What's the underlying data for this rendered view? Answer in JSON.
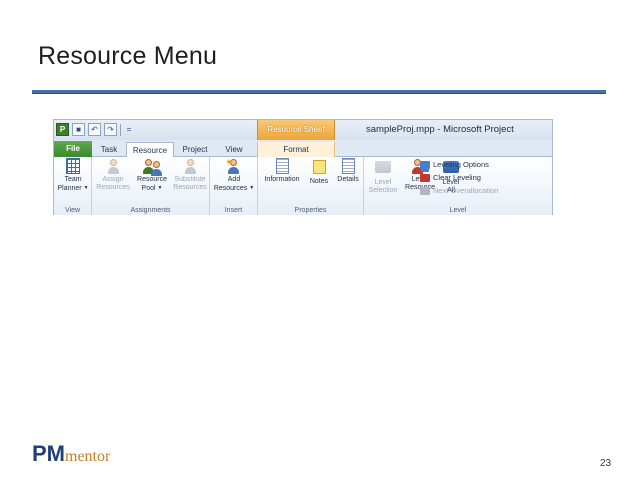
{
  "slide": {
    "title": "Resource Menu",
    "page_number": "23"
  },
  "logo": {
    "pm": "PM",
    "rest": "mentor",
    "colors": {
      "pm": "#1f3f7a",
      "rest": "#c57f23"
    }
  },
  "ribbon": {
    "window_title": "sampleProj.mpp  -  Microsoft Project",
    "contextual_tab_header": "Resource Sheet Tools",
    "quick_access": {
      "app_icon": "project-app-icon",
      "undo": "↶",
      "redo": "↷",
      "menu": "="
    },
    "tabs": {
      "file": "File",
      "task": "Task",
      "resource": "Resource",
      "project": "Project",
      "view": "View",
      "format": "Format"
    },
    "groups": {
      "view": {
        "label": "View",
        "team_planner": [
          "Team",
          "Planner"
        ]
      },
      "assignments": {
        "label": "Assignments",
        "assign_resources": [
          "Assign",
          "Resources"
        ],
        "resource_pool": [
          "Resource",
          "Pool"
        ],
        "substitute_resources": [
          "Substitute",
          "Resources"
        ]
      },
      "insert": {
        "label": "Insert",
        "add_resources": [
          "Add",
          "Resources"
        ]
      },
      "properties": {
        "label": "Properties",
        "information": "Information",
        "notes": "Notes",
        "details": "Details"
      },
      "level": {
        "label": "Level",
        "level_selection": [
          "Level",
          "Selection"
        ],
        "level_resource": [
          "Level",
          "Resource"
        ],
        "level_all": [
          "Level",
          "All"
        ],
        "leveling_options": "Leveling Options",
        "clear_leveling": "Clear Leveling",
        "next_overallocation": "Next Overallocation"
      }
    },
    "colors": {
      "file_tab": "#3b8a2d",
      "contextual_tab": "#eea436",
      "ribbon_border": "#a9b8cf"
    }
  }
}
